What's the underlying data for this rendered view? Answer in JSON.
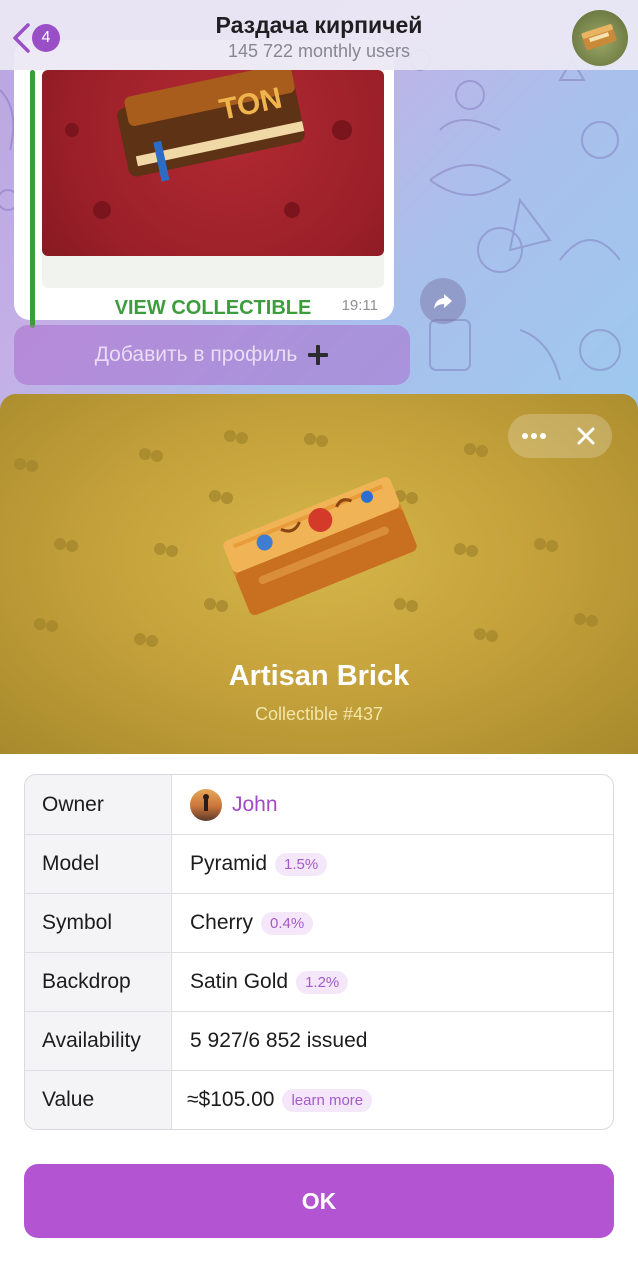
{
  "header": {
    "title": "Раздача кирпичей",
    "subtitle": "145 722 monthly users",
    "back_badge": "4"
  },
  "message": {
    "card_label": "TON",
    "view_button": "VIEW COLLECTIBLE",
    "time": "19:11"
  },
  "add_profile": {
    "label": "Добавить в профиль"
  },
  "gift": {
    "name": "Artisan Brick",
    "number": "Collectible #437"
  },
  "info": {
    "rows": [
      {
        "key": "Owner",
        "value": "John"
      },
      {
        "key": "Model",
        "value": "Pyramid",
        "rarity": "1.5%"
      },
      {
        "key": "Symbol",
        "value": "Cherry",
        "rarity": "0.4%"
      },
      {
        "key": "Backdrop",
        "value": "Satin Gold",
        "rarity": "1.2%"
      },
      {
        "key": "Availability",
        "value": "5 927/6 852 issued"
      },
      {
        "key": "Value",
        "value": "≈$105.00",
        "link": "learn more"
      }
    ]
  },
  "ok_button": "OK",
  "colors": {
    "accent_purple": "#b355d3",
    "link_purple": "#a448c8",
    "collectible_green": "#3d9d3d",
    "backdrop_gold": "#c6a33c"
  },
  "icons": [
    "back-chevron-icon",
    "share-icon",
    "plus-icon",
    "more-icon",
    "close-icon"
  ]
}
